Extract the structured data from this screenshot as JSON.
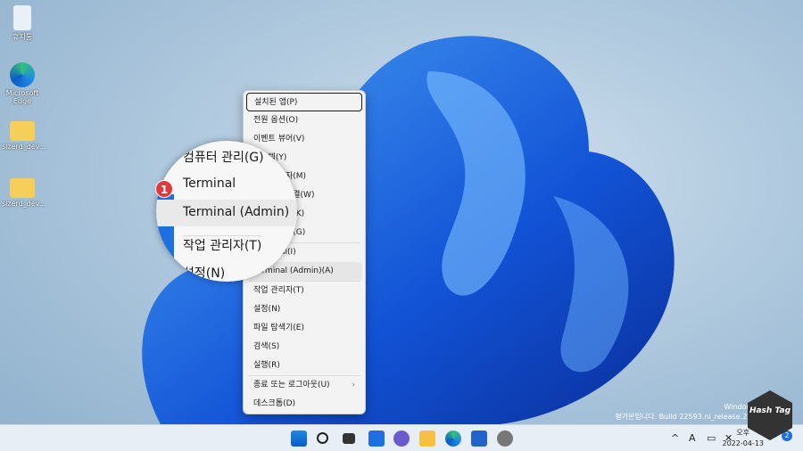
{
  "desktop": {
    "icons": [
      {
        "label": "휴지통"
      },
      {
        "label": "Microsoft Edge"
      },
      {
        "label": "sizerd_dev..."
      },
      {
        "label": "sizerd_dev..."
      }
    ]
  },
  "menu": {
    "items": [
      {
        "label": "설치된 앱(P)"
      },
      {
        "label": "전원 옵션(O)"
      },
      {
        "label": "이벤트 뷰어(V)"
      },
      {
        "label": "시스템(Y)"
      },
      {
        "label": "장치 관리자(M)"
      },
      {
        "label": "네트워크 연결(W)"
      },
      {
        "label": "디스크 관리(K)"
      },
      {
        "label": "컴퓨터 관리(G)"
      },
      {
        "label": "Terminal(I)"
      },
      {
        "label": "Terminal (Admin)(A)"
      },
      {
        "label": "작업 관리자(T)"
      },
      {
        "label": "설정(N)"
      },
      {
        "label": "파일 탐색기(E)"
      },
      {
        "label": "검색(S)"
      },
      {
        "label": "실행(R)"
      },
      {
        "label": "종료 또는 로그아웃(U)"
      },
      {
        "label": "데스크톱(D)"
      }
    ],
    "submenu_arrow": "›"
  },
  "magnifier": {
    "rows": [
      "컴퓨터 관리(G)",
      "Terminal",
      "Terminal (Admin)",
      "작업 관리자(T)",
      "설정(N)"
    ],
    "step_badge": "1"
  },
  "watermark": {
    "line1": "Windows 11 Home",
    "line2": "평가본입니다. Build 22593.ni_release.220330-1400"
  },
  "tray": {
    "chevron": "^",
    "ime": "A",
    "date": "2022-04-13",
    "time": "오후",
    "notif_count": "2"
  },
  "logo": {
    "text": "Hash Tag"
  },
  "colors": {
    "accent": "#1e6fe0",
    "badge": "#e5383b"
  }
}
